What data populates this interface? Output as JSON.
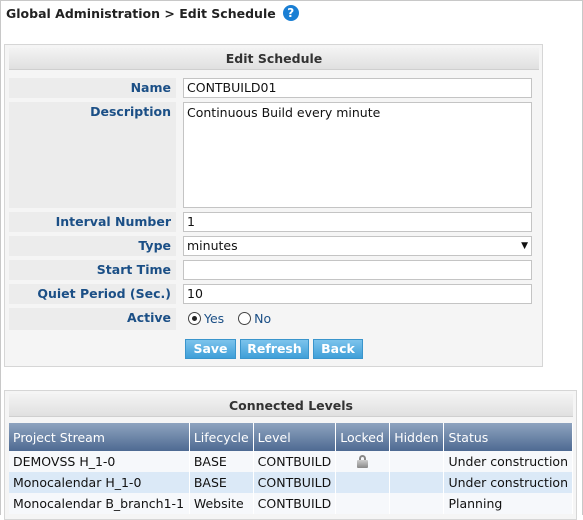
{
  "breadcrumb": {
    "text": "Global Administration > Edit Schedule",
    "help_icon": "question-circle-icon"
  },
  "edit": {
    "title": "Edit Schedule",
    "name_label": "Name",
    "name": "CONTBUILD01",
    "description_label": "Description",
    "description": "Continuous Build every minute",
    "interval_label": "Interval Number",
    "interval": "1",
    "type_label": "Type",
    "type": "minutes",
    "start_label": "Start Time",
    "start": "",
    "quiet_label": "Quiet Period (Sec.)",
    "quiet": "10",
    "active_label": "Active",
    "yes": "Yes",
    "no": "No",
    "active": "Yes",
    "save": "Save",
    "refresh": "Refresh",
    "back": "Back"
  },
  "levels": {
    "title": "Connected Levels",
    "columns": [
      "Project Stream",
      "Lifecycle",
      "Level",
      "Locked",
      "Hidden",
      "Status"
    ],
    "rows": [
      {
        "stream": "DEMOVSS H_1-0",
        "lifecycle": "BASE",
        "level": "CONTBUILD",
        "locked": true,
        "hidden": "",
        "status": "Under construction"
      },
      {
        "stream": "Monocalendar H_1-0",
        "lifecycle": "BASE",
        "level": "CONTBUILD",
        "locked": false,
        "hidden": "",
        "status": "Under construction"
      },
      {
        "stream": "Monocalendar B_branch1-1",
        "lifecycle": "Website",
        "level": "CONTBUILD",
        "locked": false,
        "hidden": "",
        "status": "Planning"
      }
    ]
  }
}
